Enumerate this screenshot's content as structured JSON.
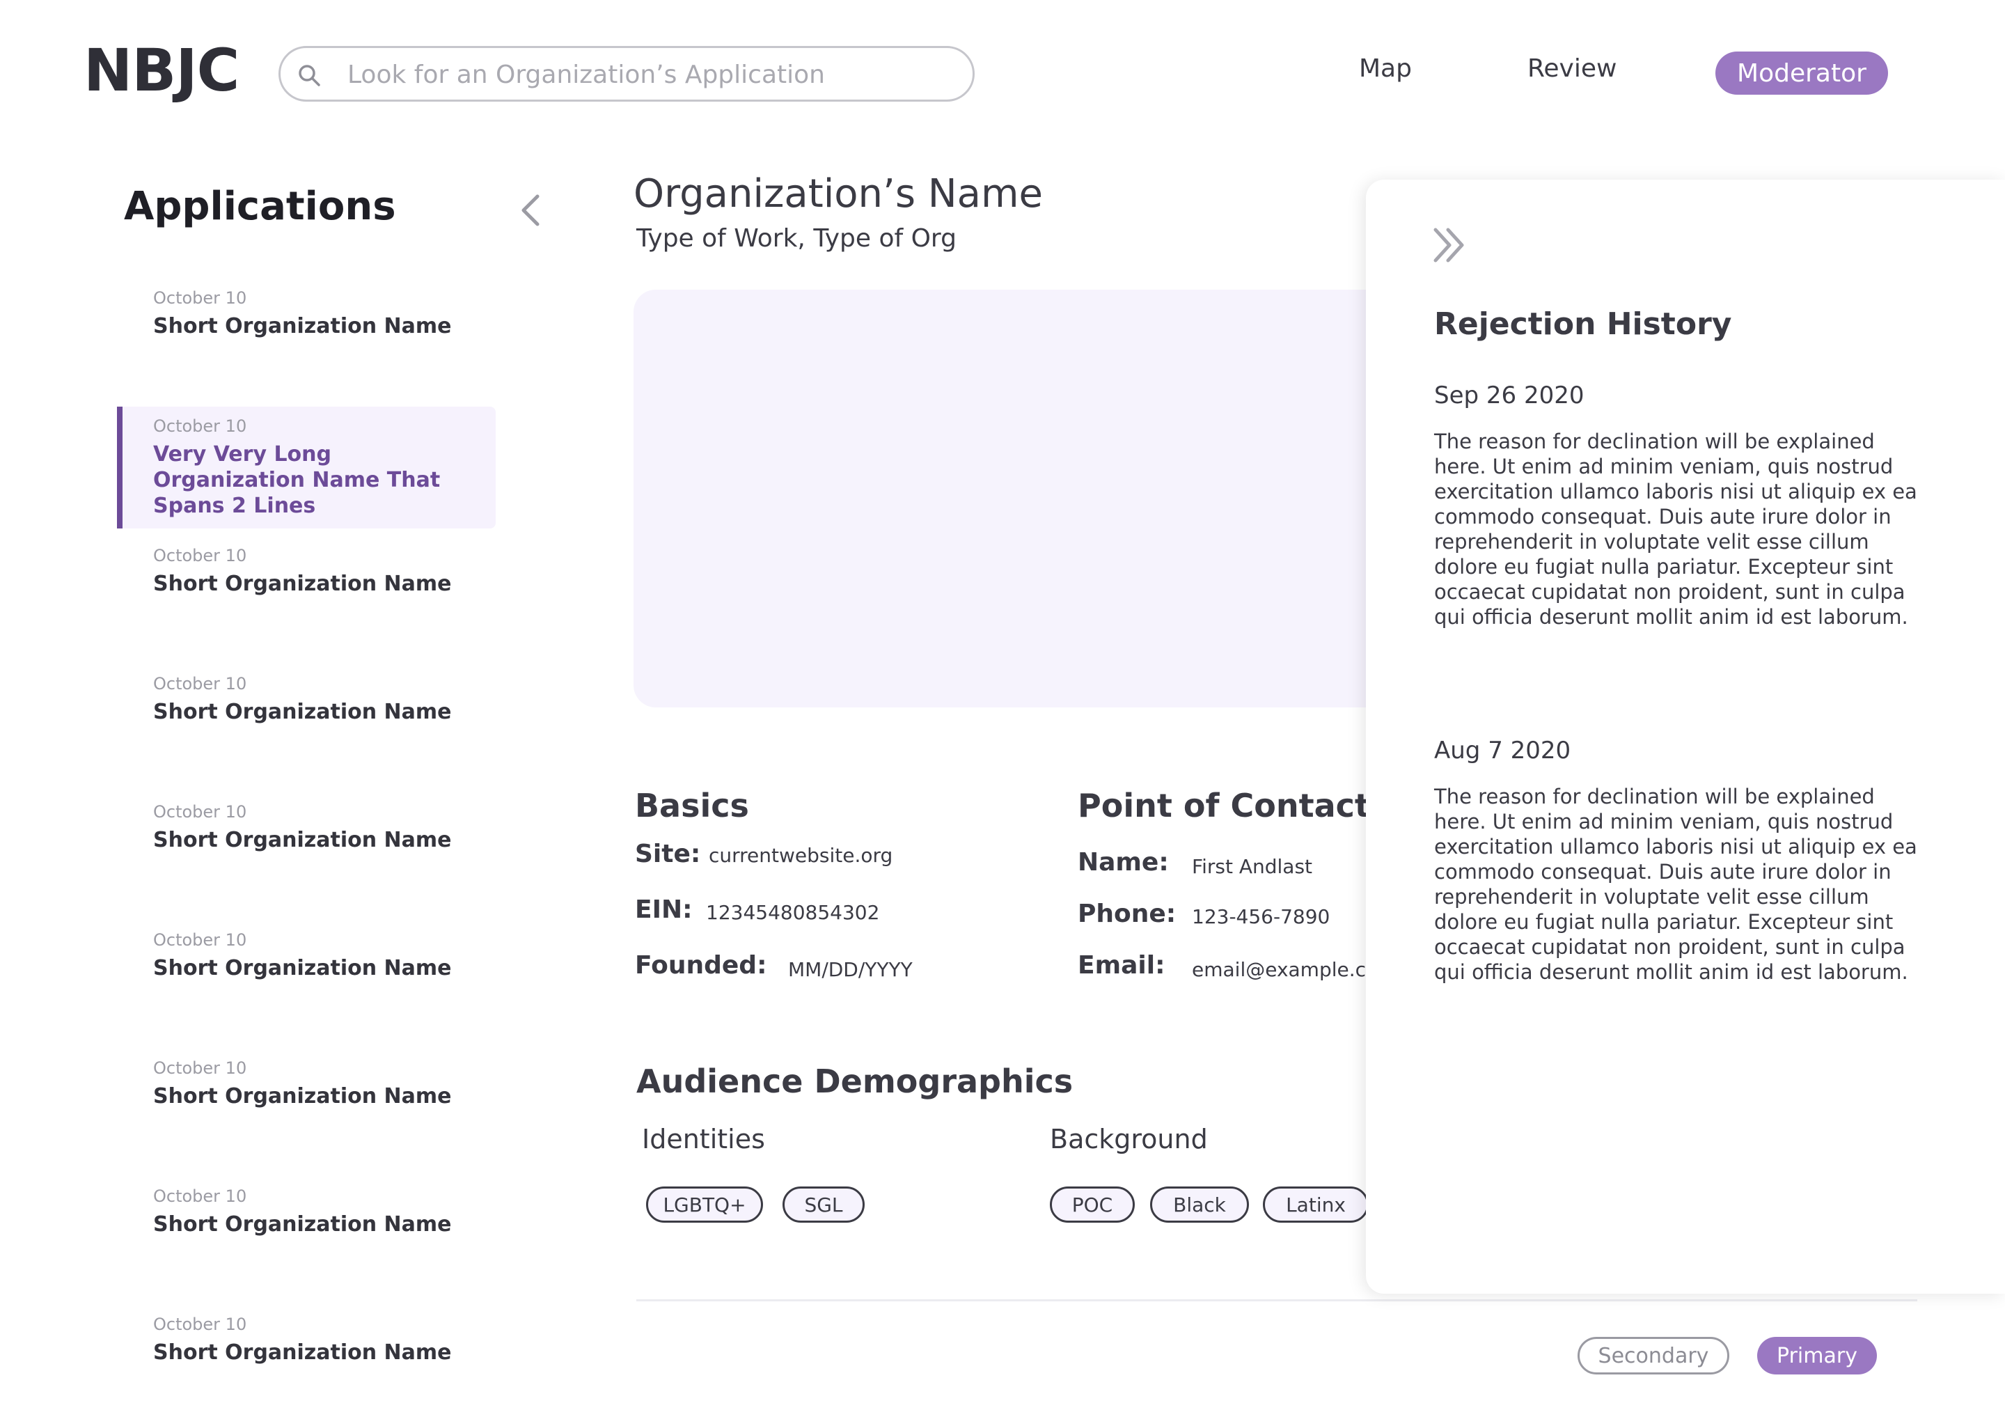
{
  "header": {
    "logo": "NBJC",
    "search_placeholder": "Look for an Organization’s Application",
    "nav": {
      "map": "Map",
      "review": "Review",
      "moderator": "Moderator"
    },
    "accent_color": "#9a78c2"
  },
  "sidebar": {
    "title": "Applications",
    "items": [
      {
        "date": "October 10",
        "name": "Short Organization Name"
      },
      {
        "date": "October 10",
        "name": "Very Very Long Organization Name That Spans 2 Lines",
        "selected": true
      },
      {
        "date": "October 10",
        "name": "Short Organization Name"
      },
      {
        "date": "October 10",
        "name": "Short Organization Name"
      },
      {
        "date": "October 10",
        "name": "Short Organization Name"
      },
      {
        "date": "October 10",
        "name": "Short Organization Name"
      },
      {
        "date": "October 10",
        "name": "Short Organization Name"
      },
      {
        "date": "October 10",
        "name": "Short Organization Name"
      },
      {
        "date": "October 10",
        "name": "Short Organization Name"
      }
    ]
  },
  "main": {
    "org_name": "Organization’s Name",
    "org_subtitle": "Type of Work, Type of Org",
    "basics": {
      "heading": "Basics",
      "site_label": "Site:",
      "site_value": "currentwebsite.org",
      "ein_label": "EIN:",
      "ein_value": "12345480854302",
      "founded_label": "Founded:",
      "founded_value": "MM/DD/YYYY"
    },
    "contact": {
      "heading": "Point of Contact",
      "name_label": "Name:",
      "name_value": "First Andlast",
      "phone_label": "Phone:",
      "phone_value": "123-456-7890",
      "email_label": "Email:",
      "email_value": "email@example.com"
    },
    "demographics": {
      "heading": "Audience Demographics",
      "identities_label": "Identities",
      "identities": [
        "LGBTQ+",
        "SGL"
      ],
      "background_label": "Background",
      "background": [
        "POC",
        "Black",
        "Latinx"
      ]
    },
    "buttons": {
      "secondary": "Secondary",
      "primary": "Primary"
    }
  },
  "rejection_panel": {
    "title": "Rejection History",
    "entries": [
      {
        "date": "Sep 26 2020",
        "text": "The reason for declination will be explained here. Ut enim ad minim veniam, quis nostrud exercitation ullamco laboris nisi ut aliquip ex ea commodo consequat. Duis aute irure dolor in reprehenderit in voluptate velit esse cillum dolore eu fugiat nulla pariatur. Excepteur sint occaecat cupidatat non proident, sunt in culpa qui officia deserunt mollit anim id est laborum."
      },
      {
        "date": "Aug 7 2020",
        "text": "The reason for declination will be explained here. Ut enim ad minim veniam, quis nostrud exercitation ullamco laboris nisi ut aliquip ex ea commodo consequat. Duis aute irure dolor in reprehenderit in voluptate velit esse cillum dolore eu fugiat nulla pariatur. Excepteur sint occaecat cupidatat non proident, sunt in culpa qui officia deserunt mollit anim id est laborum."
      }
    ]
  }
}
